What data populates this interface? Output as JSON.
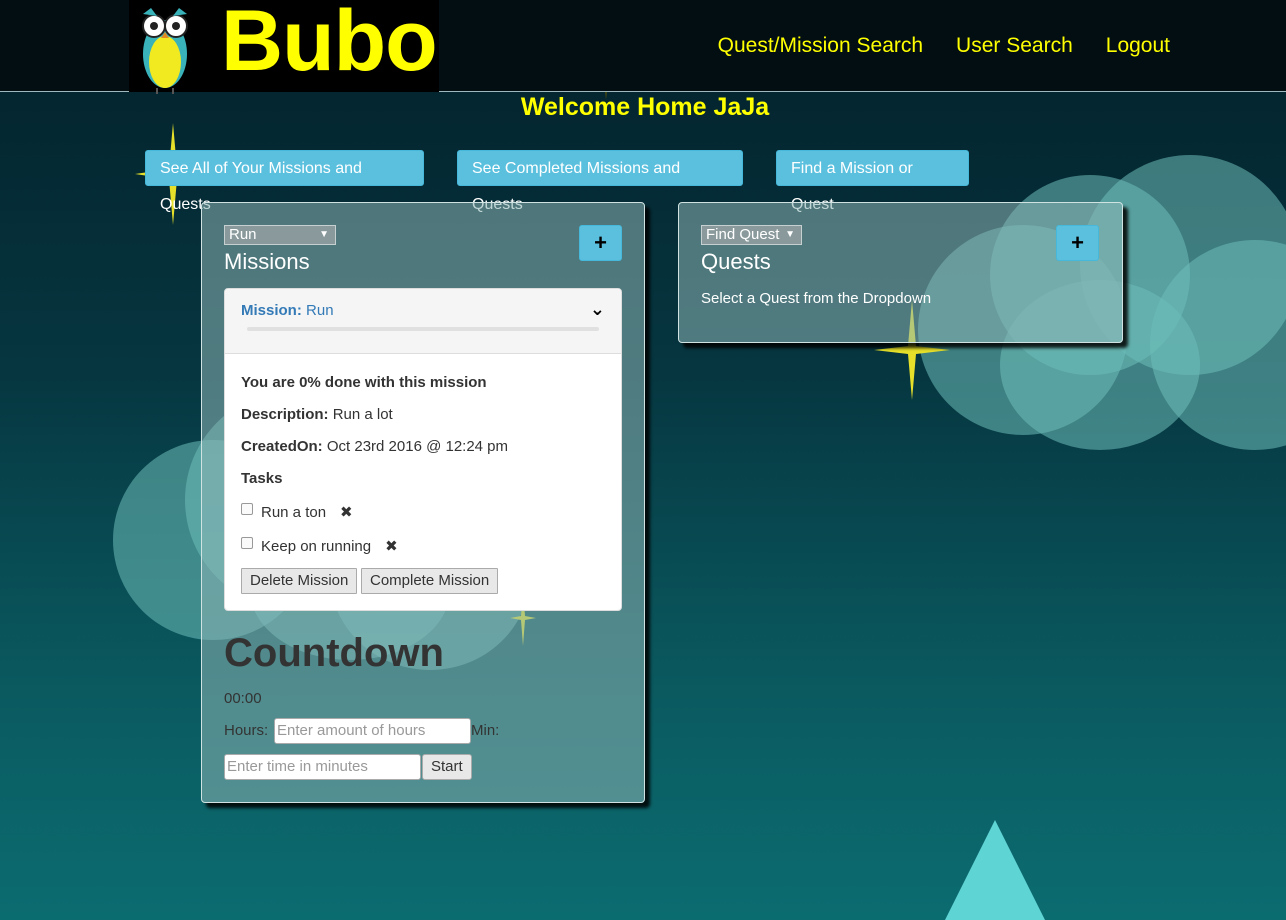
{
  "brand": {
    "name": "Bubo",
    "logo_icon": "owl-icon",
    "color": "#ffff00"
  },
  "nav": [
    {
      "label": "Quest/Mission Search"
    },
    {
      "label": "User Search"
    },
    {
      "label": "Logout"
    }
  ],
  "welcome": "Welcome Home JaJa",
  "top_buttons": [
    {
      "label": "See All of Your Missions and Quests"
    },
    {
      "label": "See Completed Missions and Quests"
    },
    {
      "label": "Find a Mission or Quest"
    }
  ],
  "missions_panel": {
    "select_value": "Run",
    "title": "Missions",
    "add_label": "+",
    "mission": {
      "prefix": "Mission:",
      "name": "Run",
      "progress_text": "You are 0% done with this mission",
      "progress_fraction": 0,
      "description_label": "Description:",
      "description": "Run a lot",
      "created_label": "CreatedOn:",
      "created": "Oct 23rd 2016 @ 12:24 pm",
      "tasks_label": "Tasks",
      "tasks": [
        {
          "label": "Run a ton",
          "checked": false
        },
        {
          "label": "Keep on running",
          "checked": false
        }
      ],
      "delete_label": "Delete Mission",
      "complete_label": "Complete Mission"
    },
    "countdown": {
      "title": "Countdown",
      "time": "00:00",
      "hours_label": "Hours:",
      "hours_placeholder": "Enter amount of hours",
      "min_label": "Min:",
      "min_placeholder": "Enter time in minutes",
      "start_label": "Start"
    }
  },
  "quests_panel": {
    "select_value": "Find Quest",
    "title": "Quests",
    "add_label": "+",
    "empty_text": "Select a Quest from the Dropdown"
  },
  "colors": {
    "accent": "#5bc0de",
    "brand_yellow": "#ffff00",
    "link_blue": "#337ab7"
  }
}
